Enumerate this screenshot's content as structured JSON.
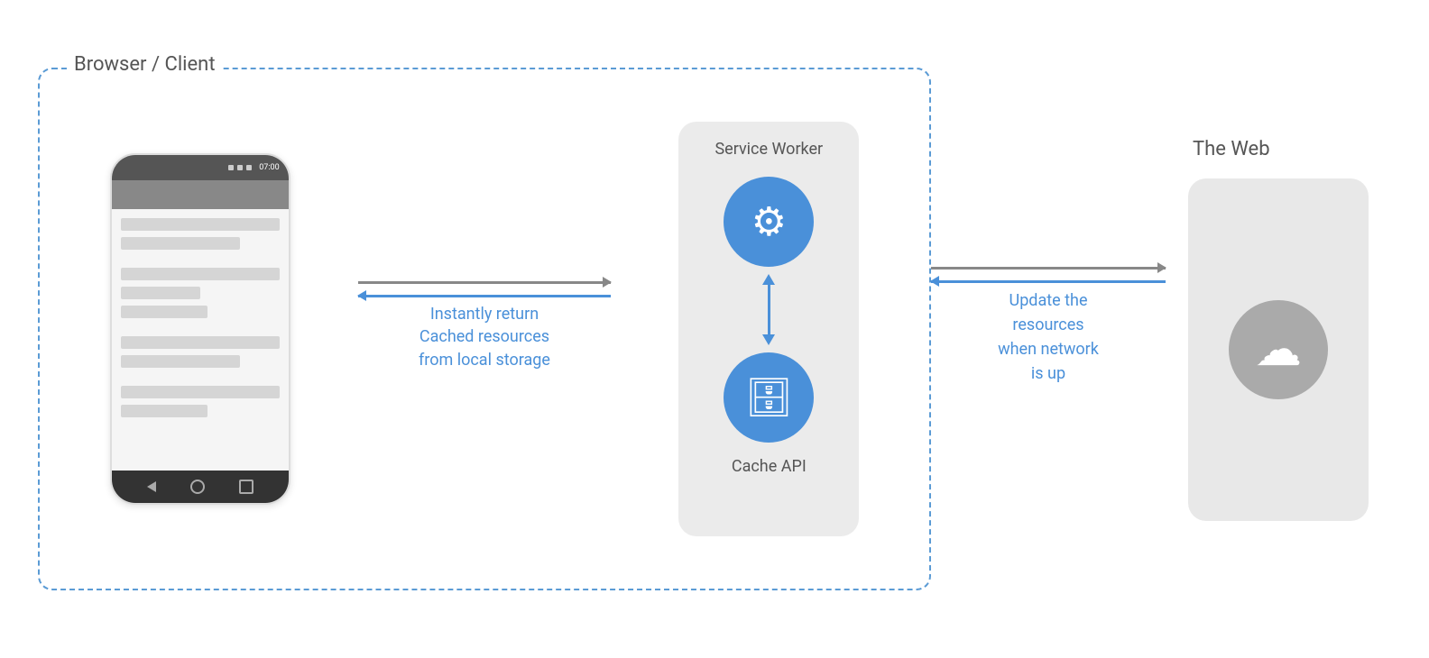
{
  "labels": {
    "browser_client": "Browser / Client",
    "the_web": "The Web",
    "service_worker": "Service Worker",
    "cache_api": "Cache API",
    "instantly_return_line1": "Instantly return",
    "instantly_return_line2": "Cached resources",
    "instantly_return_line3": "from local storage",
    "update_the_line1": "Update the",
    "update_the_line2": "resources",
    "update_the_line3": "when network",
    "update_the_line4": "is up"
  },
  "phone": {
    "time": "07:00"
  }
}
